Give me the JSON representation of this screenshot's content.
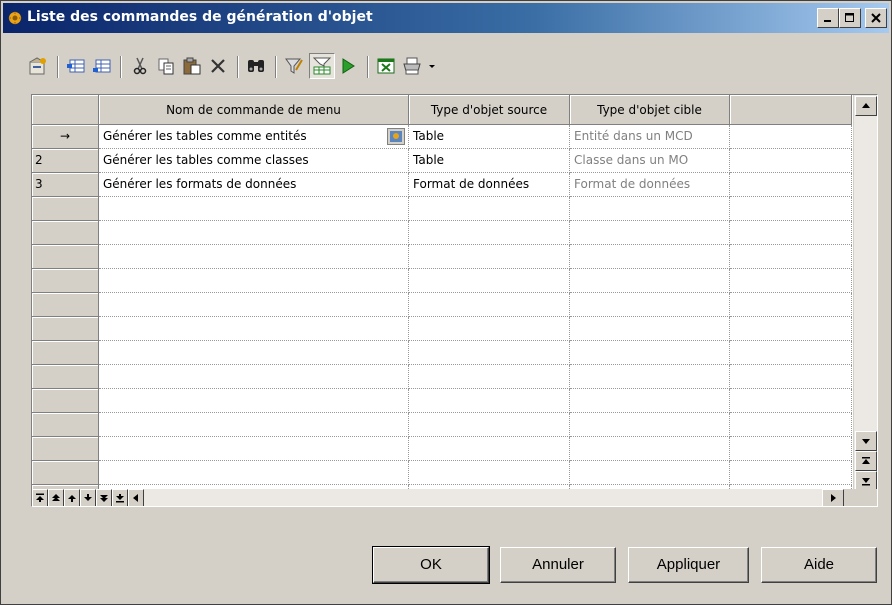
{
  "window": {
    "title": "Liste des commandes de génération d'objet",
    "controls": [
      "minimize",
      "maximize",
      "close"
    ]
  },
  "toolbar": {
    "icons": [
      "properties-icon",
      "insert-row-icon",
      "add-row-icon",
      "cut-icon",
      "copy-icon",
      "paste-icon",
      "delete-icon",
      "find-icon",
      "filter-icon",
      "customize-columns-icon",
      "run-icon",
      "export-excel-icon",
      "print-icon",
      "dropdown-arrow-icon"
    ]
  },
  "grid": {
    "columns": [
      "Nom de commande de menu",
      "Type d'objet source",
      "Type d'objet cible",
      ""
    ],
    "rows": [
      {
        "header": "→",
        "name": "Générer les tables comme entités",
        "source": "Table",
        "target": "Entité dans un MCD"
      },
      {
        "header": "2",
        "name": "Générer les tables comme classes",
        "source": "Table",
        "target": "Classe dans un MO"
      },
      {
        "header": "3",
        "name": "Générer les formats de données",
        "source": "Format de données",
        "target": "Format de données"
      }
    ],
    "empty_rows": 13
  },
  "buttons": {
    "ok": "OK",
    "cancel": "Annuler",
    "apply": "Appliquer",
    "help": "Aide"
  },
  "colors": {
    "title_gradient_start": "#0a246a",
    "title_gradient_end": "#a6caf0",
    "face": "#d4d0c8",
    "disabled_text": "#808080"
  }
}
